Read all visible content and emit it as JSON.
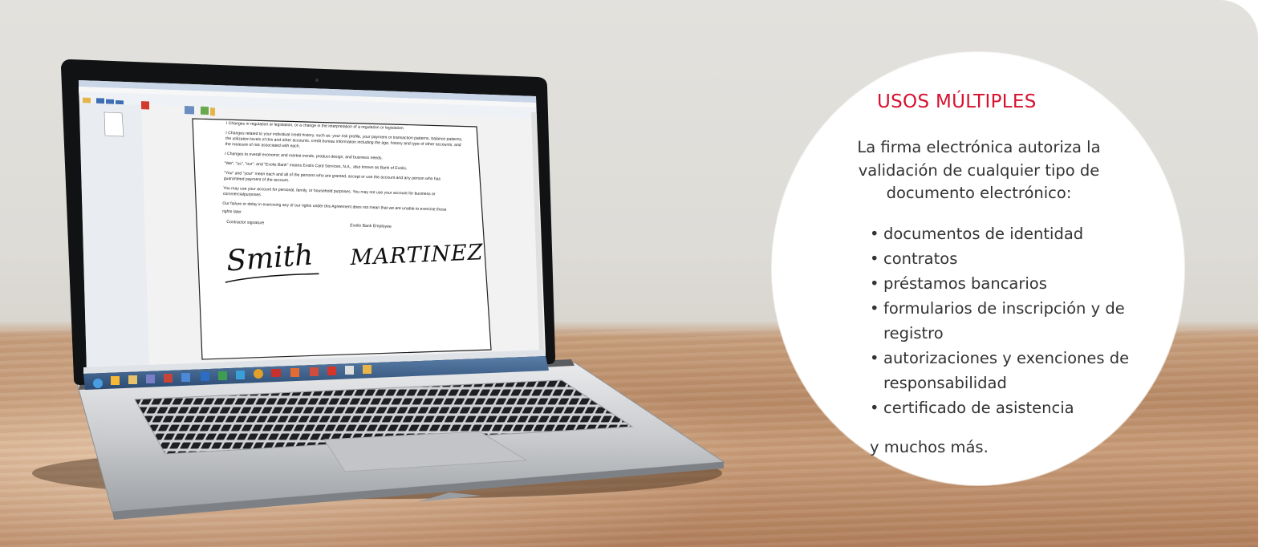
{
  "banner": {
    "heading": "USOS MÚLTIPLES",
    "intro": "La firma electrónica autoriza la validación de cualquier tipo de documento electrónico:",
    "items": [
      "documentos de identidad",
      "contratos",
      "préstamos bancarios",
      "formularios de inscripción y de registro",
      "autorizaciones y exenciones de responsabilidad",
      "certificado de asistencia"
    ],
    "outro": "y muchos más.",
    "bullet": "•",
    "accent_color": "#d7112f",
    "text_color": "#333333"
  },
  "laptop_screen": {
    "paragraphs": [
      "I Changes in regulation or legislation, or a change in the interpretation of a regulation or legislation.",
      "I Changes related to your individual credit history, such as: your risk profile, your payment or transaction patterns, balance patterns, the utilization levels of this and other accounts, credit bureau information including the age, history and type of other accounts, and the measure of risk associated with each.",
      "I Changes to overall economic and market trends, product design, and business needs.",
      "\"We\", \"us\", \"our\", and \"Evolis Bank\" means Evolis Card Services, N.A., also known as Bank of Evolis.",
      "\"You\" and \"your\" mean each and all of the persons who are granted, accept or use the account and any person who has guaranteed payment of the account.",
      "You may use your account for personal, family, or household purposes. You may not use your account for business or commercialpurposes.",
      "Our failure or delay in exercising any of our rights under this Agreement does not mean that we are unable to exercise those",
      "rights later."
    ],
    "signature_label_left": "Contractor signature",
    "signature_label_right": "Evolis Bank Employee",
    "signature_left": "Smith",
    "signature_right": "MARTINEZ"
  }
}
